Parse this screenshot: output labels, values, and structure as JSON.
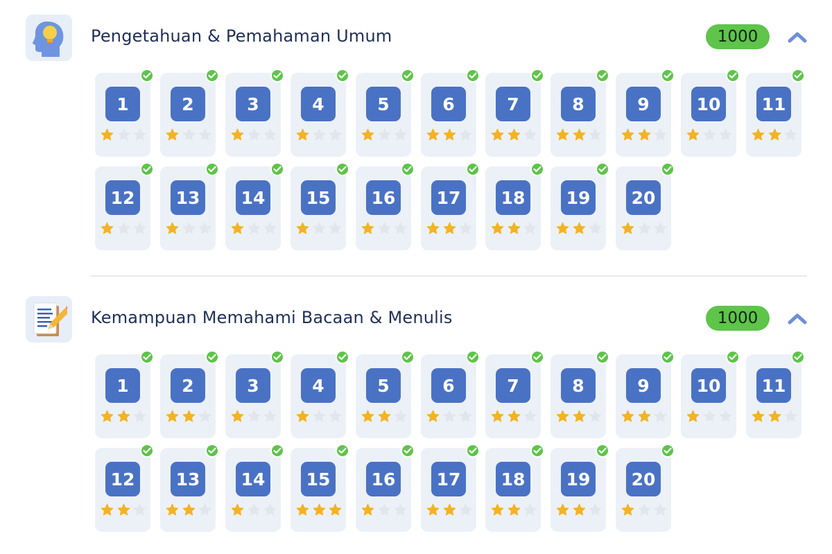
{
  "colors": {
    "card_bg": "#ecf1f8",
    "number_bg": "#4a72c4",
    "badge_green": "#5ec44a",
    "star_filled": "#f3b322",
    "star_empty": "#e2e6ec",
    "title": "#1f2f57",
    "chevron": "#6f8fd8"
  },
  "sections": [
    {
      "title": "Pengetahuan & Pemahaman Umum",
      "icon": "head-lightbulb-icon",
      "score": "1000",
      "items": [
        {
          "label": "1",
          "stars": 1,
          "completed": true
        },
        {
          "label": "2",
          "stars": 1,
          "completed": true
        },
        {
          "label": "3",
          "stars": 1,
          "completed": true
        },
        {
          "label": "4",
          "stars": 1,
          "completed": true
        },
        {
          "label": "5",
          "stars": 1,
          "completed": true
        },
        {
          "label": "6",
          "stars": 2,
          "completed": true
        },
        {
          "label": "7",
          "stars": 2,
          "completed": true
        },
        {
          "label": "8",
          "stars": 2,
          "completed": true
        },
        {
          "label": "9",
          "stars": 2,
          "completed": true
        },
        {
          "label": "10",
          "stars": 1,
          "completed": true
        },
        {
          "label": "11",
          "stars": 2,
          "completed": true
        },
        {
          "label": "12",
          "stars": 1,
          "completed": true
        },
        {
          "label": "13",
          "stars": 1,
          "completed": true
        },
        {
          "label": "14",
          "stars": 1,
          "completed": true
        },
        {
          "label": "15",
          "stars": 1,
          "completed": true
        },
        {
          "label": "16",
          "stars": 1,
          "completed": true
        },
        {
          "label": "17",
          "stars": 2,
          "completed": true
        },
        {
          "label": "18",
          "stars": 2,
          "completed": true
        },
        {
          "label": "19",
          "stars": 2,
          "completed": true
        },
        {
          "label": "20",
          "stars": 1,
          "completed": true
        }
      ]
    },
    {
      "title": "Kemampuan Memahami Bacaan & Menulis",
      "icon": "document-pencil-icon",
      "score": "1000",
      "items": [
        {
          "label": "1",
          "stars": 2,
          "completed": true
        },
        {
          "label": "2",
          "stars": 2,
          "completed": true
        },
        {
          "label": "3",
          "stars": 1,
          "completed": true
        },
        {
          "label": "4",
          "stars": 1,
          "completed": true
        },
        {
          "label": "5",
          "stars": 2,
          "completed": true
        },
        {
          "label": "6",
          "stars": 1,
          "completed": true
        },
        {
          "label": "7",
          "stars": 2,
          "completed": true
        },
        {
          "label": "8",
          "stars": 2,
          "completed": true
        },
        {
          "label": "9",
          "stars": 2,
          "completed": true
        },
        {
          "label": "10",
          "stars": 1,
          "completed": true
        },
        {
          "label": "11",
          "stars": 2,
          "completed": true
        },
        {
          "label": "12",
          "stars": 2,
          "completed": true
        },
        {
          "label": "13",
          "stars": 2,
          "completed": true
        },
        {
          "label": "14",
          "stars": 1,
          "completed": true
        },
        {
          "label": "15",
          "stars": 3,
          "completed": true
        },
        {
          "label": "16",
          "stars": 1,
          "completed": true
        },
        {
          "label": "17",
          "stars": 2,
          "completed": true
        },
        {
          "label": "18",
          "stars": 2,
          "completed": true
        },
        {
          "label": "19",
          "stars": 2,
          "completed": true
        },
        {
          "label": "20",
          "stars": 1,
          "completed": true
        }
      ]
    }
  ]
}
